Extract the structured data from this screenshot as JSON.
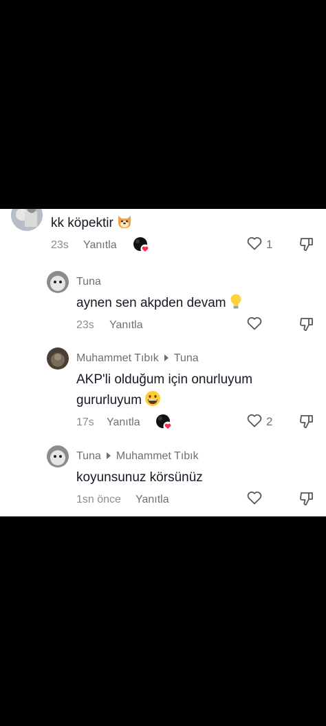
{
  "comments": [
    {
      "text": "kk köpektir",
      "emoji": "dog-face-emoji",
      "time": "23s",
      "reply": "Yanıtla",
      "likes": "1",
      "liked_by_creator": true
    },
    {
      "author": "Tuna",
      "text": "aynen sen akpden devam",
      "emoji": "light-bulb-emoji",
      "time": "23s",
      "reply": "Yanıtla",
      "likes": "",
      "liked_by_creator": false
    },
    {
      "author": "Muhammet Tıbık",
      "reply_to": "Tuna",
      "text_line1": "AKP'li olduğum için onurluyum",
      "text_line2": "gururluyum",
      "emoji": "grinning-face-emoji",
      "time": "17s",
      "reply": "Yanıtla",
      "likes": "2",
      "liked_by_creator": true
    },
    {
      "author": "Tuna",
      "reply_to": "Muhammet Tıbık",
      "text": "koyunsunuz körsünüz",
      "time": "1sn önce",
      "reply": "Yanıtla",
      "likes": "",
      "liked_by_creator": false
    }
  ],
  "colors": {
    "background": "#000000",
    "panel": "#ffffff",
    "text": "#161823",
    "secondary": "#6f6f73",
    "heart_badge": "#fe2c55"
  }
}
